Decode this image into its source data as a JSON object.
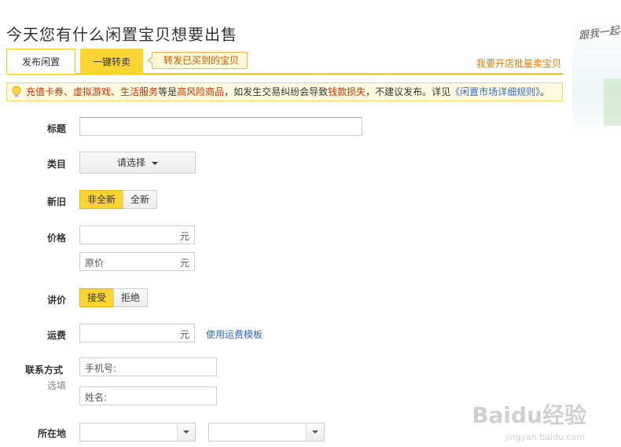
{
  "page": {
    "title": "今天您有什么闲置宝贝想要出售"
  },
  "tabs": [
    {
      "label": "发布闲置",
      "active": true
    },
    {
      "label": "一键转卖",
      "active": false
    }
  ],
  "tab_tip": "转发已买到的宝贝",
  "batch_link": "我要开店批量卖宝贝",
  "notice": {
    "item1": "充值卡券",
    "sep1": "、",
    "item2": "虚拟游戏",
    "sep2": "、",
    "item3": "生活服务",
    "text1": "等是",
    "risk": "高风险商品",
    "text2": "，如发生交易纠纷会导致",
    "loss": "钱款损失",
    "text3": "，不建议发布。详见",
    "rule_link": "《闲置市场详细规则》",
    "end": "。"
  },
  "form": {
    "title_label": "标题",
    "title_value": "",
    "category_label": "类目",
    "category_select": "请选择",
    "condition_label": "新旧",
    "condition_options": [
      "非全新",
      "全新"
    ],
    "condition_selected": "非全新",
    "price_label": "价格",
    "price_value": "",
    "price_unit": "元",
    "original_price_placeholder": "原价",
    "original_price_unit": "元",
    "bargain_label": "讲价",
    "bargain_options": [
      "接受",
      "拒绝"
    ],
    "bargain_selected": "接受",
    "shipping_label": "运费",
    "shipping_value": "",
    "shipping_unit": "元",
    "shipping_template_link": "使用运费模板",
    "contact_label": "联系方式",
    "contact_optional": "选填",
    "phone_placeholder": "手机号:",
    "name_placeholder": "姓名:",
    "location_label": "所在地",
    "location_province": "",
    "location_city": ""
  },
  "decor": {
    "handwriting": "跟我一起填写"
  },
  "watermark": {
    "brand": "Baidu经验",
    "url": "jingyan.baidu.com"
  },
  "colors": {
    "accent": "#fcd434",
    "warning": "#d42a00",
    "link": "#3366cc",
    "orange": "#e07a00"
  }
}
